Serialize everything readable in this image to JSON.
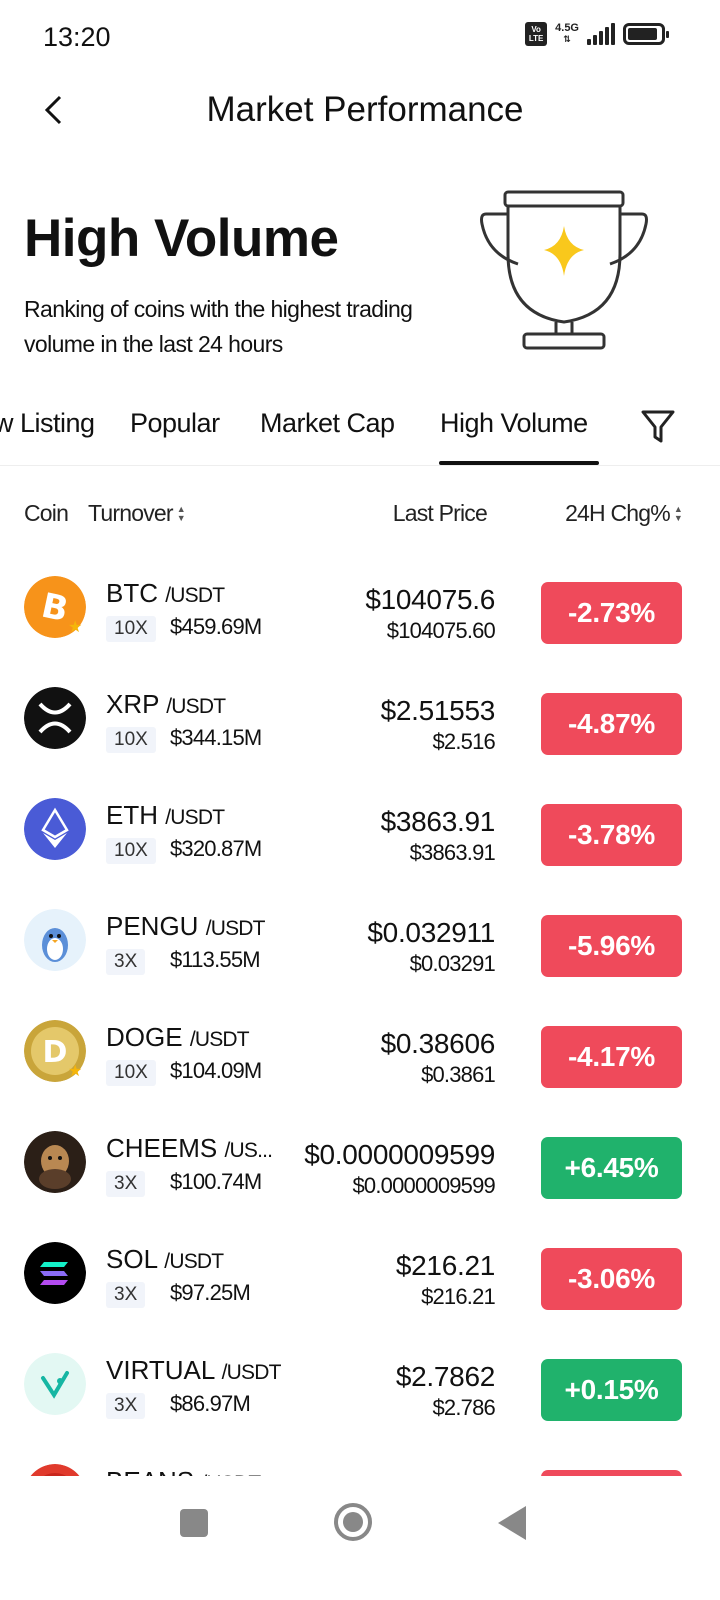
{
  "status_bar": {
    "time": "13:20",
    "volte": "Vo LTE",
    "network": "4.5G",
    "battery_level": 0.9
  },
  "header": {
    "title": "Market Performance"
  },
  "hero": {
    "title": "High Volume",
    "description": "Ranking of coins with the highest trading volume in the last 24 hours",
    "icon": "trophy-icon"
  },
  "tabs": [
    {
      "label": "w Listing",
      "active": false
    },
    {
      "label": "Popular",
      "active": false
    },
    {
      "label": "Market Cap",
      "active": false
    },
    {
      "label": "High Volume",
      "active": true
    }
  ],
  "columns": {
    "coin": "Coin",
    "turnover": "Turnover",
    "last_price": "Last Price",
    "change": "24H Chg%"
  },
  "colors": {
    "negative": "#ef4a5b",
    "positive": "#20b26c",
    "badge_bg": "#f1f4fa",
    "star": "#f5b50a"
  },
  "rows": [
    {
      "symbol": "BTC",
      "quote": "/USDT",
      "leverage": "10X",
      "turnover": "$459.69M",
      "price": "$104075.6",
      "fiat": "$104075.60",
      "change": "-2.73%",
      "direction": "down",
      "favorite": true,
      "logo": "bitcoin-logo"
    },
    {
      "symbol": "XRP",
      "quote": "/USDT",
      "leverage": "10X",
      "turnover": "$344.15M",
      "price": "$2.51553",
      "fiat": "$2.516",
      "change": "-4.87%",
      "direction": "down",
      "favorite": false,
      "logo": "xrp-logo"
    },
    {
      "symbol": "ETH",
      "quote": "/USDT",
      "leverage": "10X",
      "turnover": "$320.87M",
      "price": "$3863.91",
      "fiat": "$3863.91",
      "change": "-3.78%",
      "direction": "down",
      "favorite": false,
      "logo": "ethereum-logo"
    },
    {
      "symbol": "PENGU",
      "quote": "/USDT",
      "leverage": "3X",
      "turnover": "$113.55M",
      "price": "$0.032911",
      "fiat": "$0.03291",
      "change": "-5.96%",
      "direction": "down",
      "favorite": false,
      "logo": "pengu-logo"
    },
    {
      "symbol": "DOGE",
      "quote": "/USDT",
      "leverage": "10X",
      "turnover": "$104.09M",
      "price": "$0.38606",
      "fiat": "$0.3861",
      "change": "-4.17%",
      "direction": "down",
      "favorite": true,
      "logo": "doge-logo"
    },
    {
      "symbol": "CHEEMS",
      "quote": "/US...",
      "leverage": "3X",
      "turnover": "$100.74M",
      "price": "$0.0000009599",
      "fiat": "$0.0000009599",
      "change": "+6.45%",
      "direction": "up",
      "favorite": false,
      "logo": "cheems-logo"
    },
    {
      "symbol": "SOL",
      "quote": "/USDT",
      "leverage": "3X",
      "turnover": "$97.25M",
      "price": "$216.21",
      "fiat": "$216.21",
      "change": "-3.06%",
      "direction": "down",
      "favorite": false,
      "logo": "solana-logo"
    },
    {
      "symbol": "VIRTUAL",
      "quote": "/USDT",
      "leverage": "3X",
      "turnover": "$86.97M",
      "price": "$2.7862",
      "fiat": "$2.786",
      "change": "+0.15%",
      "direction": "up",
      "favorite": false,
      "logo": "virtual-logo"
    },
    {
      "symbol": "BEANS",
      "quote": "/USDT",
      "leverage": "",
      "turnover": "",
      "price": "",
      "fiat": "",
      "change": "",
      "direction": "down",
      "favorite": false,
      "logo": "beans-logo"
    }
  ]
}
